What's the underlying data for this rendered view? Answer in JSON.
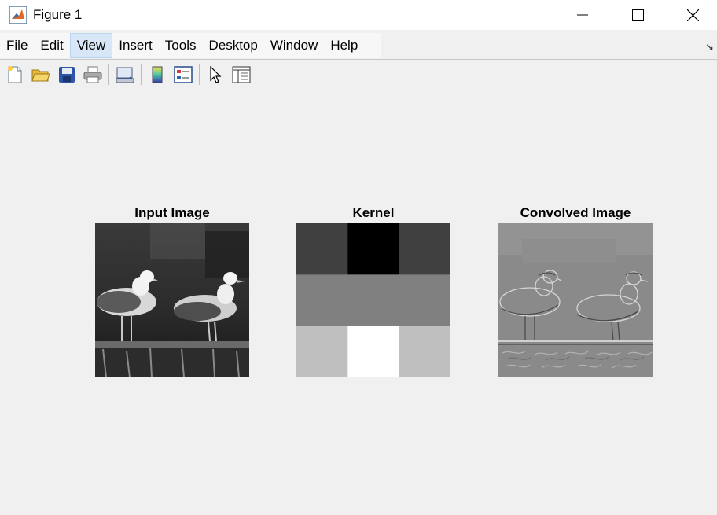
{
  "window": {
    "title": "Figure 1"
  },
  "menu": [
    "File",
    "Edit",
    "View",
    "Insert",
    "Tools",
    "Desktop",
    "Window",
    "Help"
  ],
  "active_menu": "View",
  "toolbar": {
    "icons": [
      "new-figure-icon",
      "open-file-icon",
      "save-icon",
      "print-icon",
      "link-plot-icon",
      "insert-colorbar-icon",
      "insert-legend-icon",
      "edit-plot-pointer-icon",
      "property-inspector-icon"
    ]
  },
  "panels": [
    {
      "title": "Input Image"
    },
    {
      "title": "Kernel"
    },
    {
      "title": "Convolved Image"
    }
  ],
  "kernel": {
    "gray_levels": [
      [
        0.25,
        0.0,
        0.25
      ],
      [
        0.5,
        0.5,
        0.5
      ],
      [
        0.75,
        1.0,
        0.75
      ]
    ]
  },
  "colors": {
    "accent_menu": "#d7e7f7",
    "background": "#f0f0f0"
  }
}
